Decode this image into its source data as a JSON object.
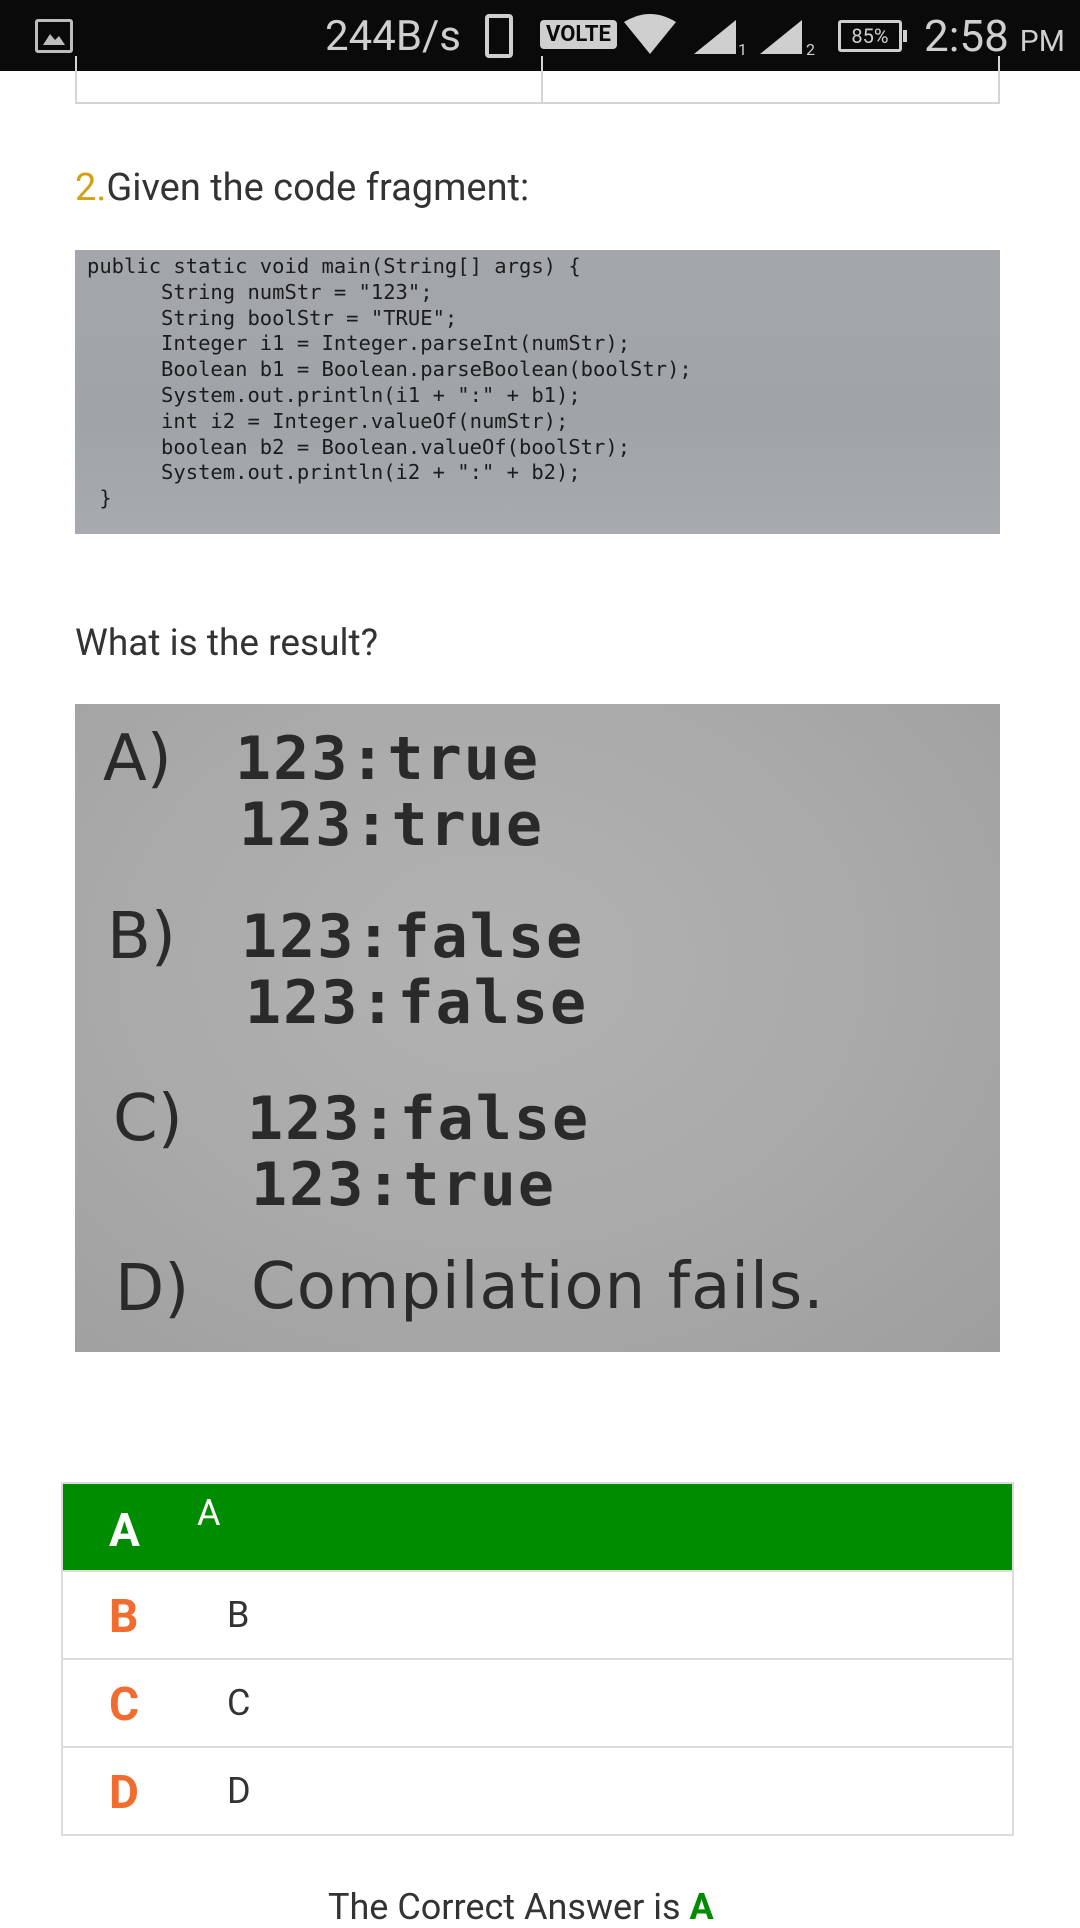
{
  "status_bar": {
    "speed": "244B/s",
    "network_badge": "VOLTE",
    "sim1_label": "1",
    "sim2_label": "2",
    "battery": "85%",
    "time": "2:58",
    "ampm": "PM",
    "icons": [
      "gallery-icon",
      "phone-icon",
      "wifi-icon",
      "signal-icon",
      "signal-icon",
      "battery-icon"
    ]
  },
  "question": {
    "number": "2.",
    "title": "Given the code fragment:",
    "prompt": "What is the result?"
  },
  "code_image": {
    "lines": [
      "public static void main(String[] args) {",
      "      String numStr = \"123\";",
      "      String boolStr = \"TRUE\";",
      "      Integer i1 = Integer.parseInt(numStr);",
      "      Boolean b1 = Boolean.parseBoolean(boolStr);",
      "      System.out.println(i1 + \":\" + b1);",
      "      int i2 = Integer.valueOf(numStr);",
      "      boolean b2 = Boolean.valueOf(boolStr);",
      "      System.out.println(i2 + \":\" + b2);",
      " }"
    ]
  },
  "options_image": {
    "a_letter": "A)",
    "a_line1": "123:true",
    "a_line2": "123:true",
    "b_letter": "B)",
    "b_line1": "123:false",
    "b_line2": "123:false",
    "c_letter": "C)",
    "c_line1": "123:false",
    "c_line2": "123:true",
    "d_letter": "D)",
    "d_text": "Compilation fails."
  },
  "answers": [
    {
      "letter": "A",
      "text": "A",
      "selected": true
    },
    {
      "letter": "B",
      "text": "B",
      "selected": false
    },
    {
      "letter": "C",
      "text": "C",
      "selected": false
    },
    {
      "letter": "D",
      "text": "D",
      "selected": false
    }
  ],
  "result": {
    "prefix": "The Correct Answer is",
    "answer": "A"
  },
  "colors": {
    "selected_row": "#008c00",
    "answer_letter": "#f26b2f",
    "question_number": "#d4a017"
  }
}
